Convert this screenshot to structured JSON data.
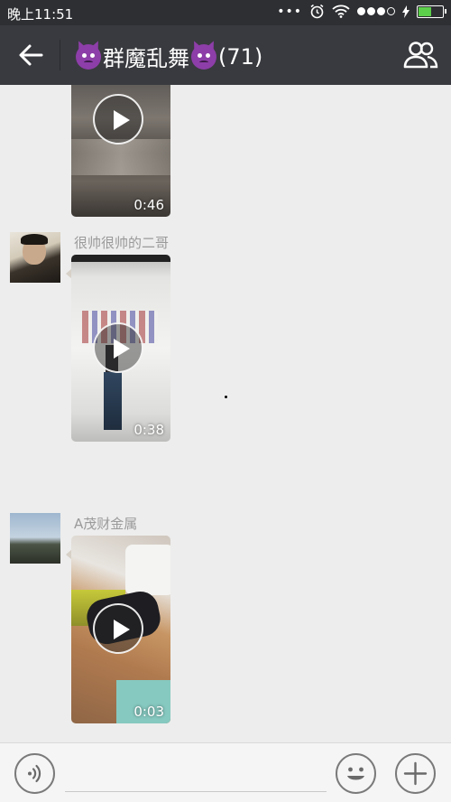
{
  "status_bar": {
    "time": "晚上11:51",
    "dots": "•••"
  },
  "header": {
    "title": "群魔乱舞",
    "member_count": "(71)"
  },
  "messages": [
    {
      "sender": "",
      "duration": "0:46"
    },
    {
      "sender": "很帅很帅的二哥",
      "duration": "0:38"
    },
    {
      "sender": "A茂财金属",
      "duration": "0:03"
    }
  ],
  "input_bar": {
    "text_value": "",
    "placeholder": ""
  }
}
